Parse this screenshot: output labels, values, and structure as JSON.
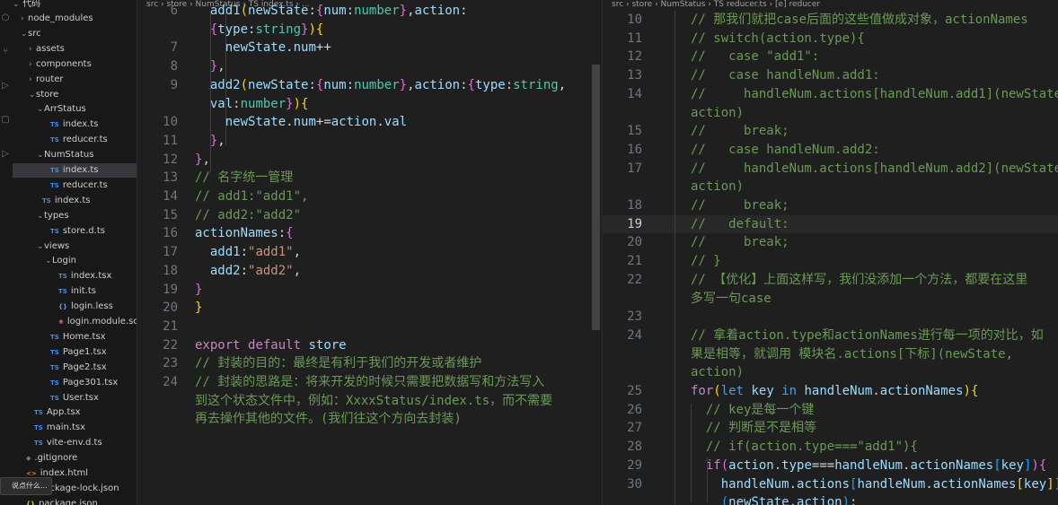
{
  "explorer": {
    "root": "代码",
    "items": [
      {
        "label": "node_modules",
        "kind": "folder",
        "expanded": false
      },
      {
        "label": "src",
        "kind": "folder",
        "expanded": true
      },
      {
        "label": "assets",
        "kind": "folder",
        "expanded": false
      },
      {
        "label": "components",
        "kind": "folder",
        "expanded": false
      },
      {
        "label": "router",
        "kind": "folder",
        "expanded": false
      },
      {
        "label": "store",
        "kind": "folder",
        "expanded": true
      },
      {
        "label": "ArrStatus",
        "kind": "folder",
        "expanded": true
      },
      {
        "label": "index.ts",
        "kind": "ts"
      },
      {
        "label": "reducer.ts",
        "kind": "ts"
      },
      {
        "label": "NumStatus",
        "kind": "folder",
        "expanded": true
      },
      {
        "label": "index.ts",
        "kind": "ts",
        "selected": true
      },
      {
        "label": "reducer.ts",
        "kind": "ts"
      },
      {
        "label": "index.ts",
        "kind": "ts"
      },
      {
        "label": "types",
        "kind": "folder",
        "expanded": true
      },
      {
        "label": "store.d.ts",
        "kind": "ts"
      },
      {
        "label": "views",
        "kind": "folder",
        "expanded": true
      },
      {
        "label": "Login",
        "kind": "folder",
        "expanded": true
      },
      {
        "label": "index.tsx",
        "kind": "tsx"
      },
      {
        "label": "init.ts",
        "kind": "ts"
      },
      {
        "label": "login.less",
        "kind": "less"
      },
      {
        "label": "login.module.scss",
        "kind": "scss"
      },
      {
        "label": "Home.tsx",
        "kind": "tsx"
      },
      {
        "label": "Page1.tsx",
        "kind": "tsx"
      },
      {
        "label": "Page2.tsx",
        "kind": "tsx"
      },
      {
        "label": "Page301.tsx",
        "kind": "tsx"
      },
      {
        "label": "User.tsx",
        "kind": "tsx"
      },
      {
        "label": "App.tsx",
        "kind": "tsx"
      },
      {
        "label": "main.tsx",
        "kind": "tsx"
      },
      {
        "label": "vite-env.d.ts",
        "kind": "ts"
      },
      {
        "label": ".gitignore",
        "kind": "git"
      },
      {
        "label": "index.html",
        "kind": "html"
      },
      {
        "label": "package-lock.json",
        "kind": "json"
      },
      {
        "label": "package.json",
        "kind": "json"
      }
    ],
    "tooltip": "说点什么..."
  },
  "left_editor": {
    "breadcrumb": "src › store › NumStatus › TS index.ts › ...",
    "lines": [
      {
        "n": "6",
        "segs": [
          [
            "p",
            "  "
          ],
          [
            "v",
            "add1"
          ],
          [
            "b1",
            "("
          ],
          [
            "v",
            "newState"
          ],
          [
            "p",
            ":"
          ],
          [
            "b2",
            "{"
          ],
          [
            "v",
            "num"
          ],
          [
            "p",
            ":"
          ],
          [
            "t",
            "number"
          ],
          [
            "b2",
            "}"
          ],
          [
            "p",
            ","
          ],
          [
            "v",
            "action"
          ],
          [
            "p",
            ":"
          ]
        ]
      },
      {
        "n": "",
        "segs": [
          [
            "p",
            "  "
          ],
          [
            "b2",
            "{"
          ],
          [
            "v",
            "type"
          ],
          [
            "p",
            ":"
          ],
          [
            "t",
            "string"
          ],
          [
            "b2",
            "}"
          ],
          [
            "b1",
            ")"
          ],
          [
            "b1",
            "{"
          ]
        ]
      },
      {
        "n": "7",
        "segs": [
          [
            "p",
            "    "
          ],
          [
            "v",
            "newState"
          ],
          [
            "p",
            "."
          ],
          [
            "v",
            "num"
          ],
          [
            "p",
            "++"
          ]
        ]
      },
      {
        "n": "8",
        "segs": [
          [
            "p",
            "  "
          ],
          [
            "b2",
            "}"
          ],
          [
            "p",
            ","
          ]
        ]
      },
      {
        "n": "9",
        "segs": [
          [
            "p",
            "  "
          ],
          [
            "v",
            "add2"
          ],
          [
            "b1",
            "("
          ],
          [
            "v",
            "newState"
          ],
          [
            "p",
            ":"
          ],
          [
            "b2",
            "{"
          ],
          [
            "v",
            "num"
          ],
          [
            "p",
            ":"
          ],
          [
            "t",
            "number"
          ],
          [
            "b2",
            "}"
          ],
          [
            "p",
            ","
          ],
          [
            "v",
            "action"
          ],
          [
            "p",
            ":"
          ],
          [
            "b2",
            "{"
          ],
          [
            "v",
            "type"
          ],
          [
            "p",
            ":"
          ],
          [
            "t",
            "string"
          ],
          [
            "p",
            ","
          ]
        ]
      },
      {
        "n": "",
        "segs": [
          [
            "p",
            "  "
          ],
          [
            "v",
            "val"
          ],
          [
            "p",
            ":"
          ],
          [
            "t",
            "number"
          ],
          [
            "b2",
            "}"
          ],
          [
            "b1",
            ")"
          ],
          [
            "b1",
            "{"
          ]
        ]
      },
      {
        "n": "10",
        "segs": [
          [
            "p",
            "    "
          ],
          [
            "v",
            "newState"
          ],
          [
            "p",
            "."
          ],
          [
            "v",
            "num"
          ],
          [
            "p",
            "+="
          ],
          [
            "v",
            "action"
          ],
          [
            "p",
            "."
          ],
          [
            "v",
            "val"
          ]
        ]
      },
      {
        "n": "11",
        "segs": [
          [
            "p",
            "  "
          ],
          [
            "b2",
            "}"
          ],
          [
            "p",
            ","
          ]
        ]
      },
      {
        "n": "12",
        "segs": [
          [
            "b2",
            "}"
          ],
          [
            "p",
            ","
          ]
        ]
      },
      {
        "n": "13",
        "segs": [
          [
            "c",
            "// 名字统一管理"
          ]
        ]
      },
      {
        "n": "14",
        "segs": [
          [
            "c",
            "// add1:\"add1\","
          ]
        ]
      },
      {
        "n": "15",
        "segs": [
          [
            "c",
            "// add2:\"add2\""
          ]
        ]
      },
      {
        "n": "16",
        "segs": [
          [
            "v",
            "actionNames"
          ],
          [
            "p",
            ":"
          ],
          [
            "b2",
            "{"
          ]
        ]
      },
      {
        "n": "17",
        "segs": [
          [
            "p",
            "  "
          ],
          [
            "v",
            "add1"
          ],
          [
            "p",
            ":"
          ],
          [
            "s",
            "\"add1\""
          ],
          [
            "p",
            ","
          ]
        ]
      },
      {
        "n": "18",
        "segs": [
          [
            "p",
            "  "
          ],
          [
            "v",
            "add2"
          ],
          [
            "p",
            ":"
          ],
          [
            "s",
            "\"add2\""
          ],
          [
            "p",
            ","
          ]
        ]
      },
      {
        "n": "19",
        "segs": [
          [
            "b2",
            "}"
          ]
        ]
      },
      {
        "n": "20",
        "segs": [
          [
            "b1",
            "}"
          ]
        ]
      },
      {
        "n": "21",
        "segs": []
      },
      {
        "n": "22",
        "segs": [
          [
            "kc",
            "export"
          ],
          [
            "p",
            " "
          ],
          [
            "kc",
            "default"
          ],
          [
            "p",
            " "
          ],
          [
            "v",
            "store"
          ]
        ]
      },
      {
        "n": "23",
        "segs": [
          [
            "c",
            "// 封装的目的：最终是有利于我们的开发或者维护"
          ]
        ]
      },
      {
        "n": "24",
        "segs": [
          [
            "c",
            "// 封装的思路是：将来开发的时候只需要把数据写和方法写入"
          ]
        ]
      },
      {
        "n": "",
        "segs": [
          [
            "c",
            "到这个状态文件中，例如：XxxxStatus/index.ts，而不需要"
          ]
        ]
      },
      {
        "n": "",
        "segs": [
          [
            "c",
            "再去操作其他的文件。(我们往这个方向去封装)"
          ]
        ]
      }
    ]
  },
  "right_editor": {
    "breadcrumb": "src › store › NumStatus › TS reducer.ts › [e] reducer",
    "lines": [
      {
        "n": "10",
        "segs": [
          [
            "c",
            "// 那我们就把case后面的这些值做成对象，actionNames"
          ]
        ]
      },
      {
        "n": "11",
        "segs": [
          [
            "c",
            "// switch(action.type){"
          ]
        ]
      },
      {
        "n": "12",
        "segs": [
          [
            "c",
            "//   case \"add1\":"
          ]
        ]
      },
      {
        "n": "13",
        "segs": [
          [
            "c",
            "//   case handleNum.add1:"
          ]
        ]
      },
      {
        "n": "14",
        "segs": [
          [
            "c",
            "//     handleNum.actions[handleNum.add1](newState,"
          ]
        ]
      },
      {
        "n": "",
        "segs": [
          [
            "c",
            "action)"
          ]
        ]
      },
      {
        "n": "15",
        "segs": [
          [
            "c",
            "//     break;"
          ]
        ]
      },
      {
        "n": "16",
        "segs": [
          [
            "c",
            "//   case handleNum.add2:"
          ]
        ]
      },
      {
        "n": "17",
        "segs": [
          [
            "c",
            "//     handleNum.actions[handleNum.add2](newState,"
          ]
        ]
      },
      {
        "n": "",
        "segs": [
          [
            "c",
            "action)"
          ]
        ]
      },
      {
        "n": "18",
        "segs": [
          [
            "c",
            "//     break;"
          ]
        ]
      },
      {
        "n": "19",
        "segs": [
          [
            "c",
            "//   default:"
          ]
        ],
        "current": true
      },
      {
        "n": "20",
        "segs": [
          [
            "c",
            "//     break;"
          ]
        ]
      },
      {
        "n": "21",
        "segs": [
          [
            "c",
            "// }"
          ]
        ]
      },
      {
        "n": "22",
        "segs": [
          [
            "c",
            "// 【优化】上面这样写，我们没添加一个方法，都要在这里"
          ]
        ]
      },
      {
        "n": "",
        "segs": [
          [
            "c",
            "多写一句case"
          ]
        ]
      },
      {
        "n": "23",
        "segs": []
      },
      {
        "n": "24",
        "segs": [
          [
            "c",
            "// 拿着action.type和actionNames进行每一项的对比，如"
          ]
        ]
      },
      {
        "n": "",
        "segs": [
          [
            "c",
            "果是相等，就调用 模块名.actions[下标](newState,"
          ]
        ]
      },
      {
        "n": "",
        "segs": [
          [
            "c",
            "action)"
          ]
        ]
      },
      {
        "n": "25",
        "segs": [
          [
            "kc",
            "for"
          ],
          [
            "b1",
            "("
          ],
          [
            "k",
            "let"
          ],
          [
            "p",
            " "
          ],
          [
            "v",
            "key"
          ],
          [
            "p",
            " "
          ],
          [
            "k",
            "in"
          ],
          [
            "p",
            " "
          ],
          [
            "v",
            "handleNum"
          ],
          [
            "p",
            "."
          ],
          [
            "v",
            "actionNames"
          ],
          [
            "b1",
            ")"
          ],
          [
            "b1",
            "{"
          ]
        ]
      },
      {
        "n": "26",
        "segs": [
          [
            "p",
            "  "
          ],
          [
            "c",
            "// key是每一个键"
          ]
        ]
      },
      {
        "n": "27",
        "segs": [
          [
            "p",
            "  "
          ],
          [
            "c",
            "// 判断是不是相等"
          ]
        ]
      },
      {
        "n": "28",
        "segs": [
          [
            "p",
            "  "
          ],
          [
            "c",
            "// if(action.type===\"add1\"){"
          ]
        ]
      },
      {
        "n": "29",
        "segs": [
          [
            "p",
            "  "
          ],
          [
            "kc",
            "if"
          ],
          [
            "b2",
            "("
          ],
          [
            "v",
            "action"
          ],
          [
            "p",
            "."
          ],
          [
            "v",
            "type"
          ],
          [
            "p",
            "==="
          ],
          [
            "v",
            "handleNum"
          ],
          [
            "p",
            "."
          ],
          [
            "v",
            "actionNames"
          ],
          [
            "b3",
            "["
          ],
          [
            "v",
            "key"
          ],
          [
            "b3",
            "]"
          ],
          [
            "b2",
            ")"
          ],
          [
            "b2",
            "{"
          ]
        ]
      },
      {
        "n": "30",
        "segs": [
          [
            "p",
            "    "
          ],
          [
            "v",
            "handleNum"
          ],
          [
            "p",
            "."
          ],
          [
            "v",
            "actions"
          ],
          [
            "b3",
            "["
          ],
          [
            "v",
            "handleNum"
          ],
          [
            "p",
            "."
          ],
          [
            "v",
            "actionNames"
          ],
          [
            "b1",
            "["
          ],
          [
            "v",
            "key"
          ],
          [
            "b1",
            "]"
          ],
          [
            "b3",
            "]"
          ]
        ]
      },
      {
        "n": "",
        "segs": [
          [
            "p",
            "    "
          ],
          [
            "b3",
            "("
          ],
          [
            "v",
            "newState"
          ],
          [
            "p",
            ","
          ],
          [
            "v",
            "action"
          ],
          [
            "b3",
            ")"
          ],
          [
            "p",
            ";"
          ]
        ]
      }
    ]
  }
}
